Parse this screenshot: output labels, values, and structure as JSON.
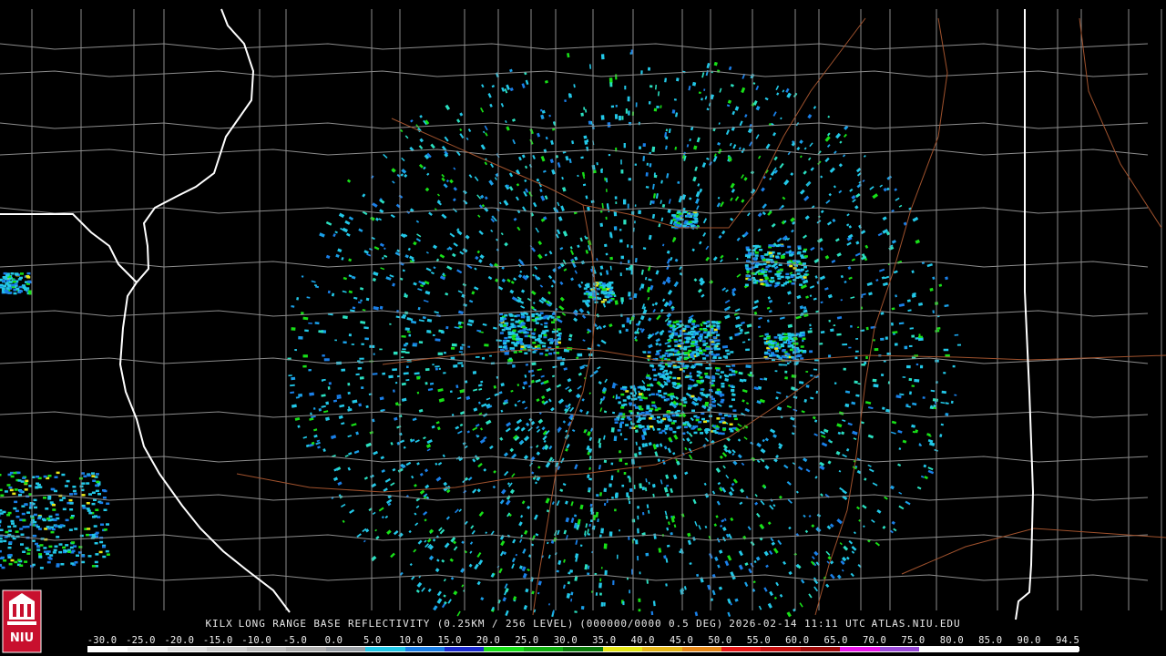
{
  "product": {
    "station": "KILX",
    "product_name": "LONG RANGE BASE REFLECTIVITY (0.25KM / 256 LEVEL)",
    "volume": "(000000/0000 0.5 DEG)",
    "datetime": "2026-02-14 11:11 UTC",
    "source": "ATLAS.NIU.EDU"
  },
  "logo": {
    "text": "NIU",
    "color": "#c8102e"
  },
  "scale": {
    "labels": [
      "-30.0",
      "-25.0",
      "-20.0",
      "-15.0",
      "-10.0",
      "-5.0",
      "0.0",
      "5.0",
      "10.0",
      "15.0",
      "20.0",
      "25.0",
      "30.0",
      "35.0",
      "40.0",
      "45.0",
      "50.0",
      "55.0",
      "60.0",
      "65.0",
      "70.0",
      "75.0",
      "80.0",
      "85.0",
      "90.0",
      "94.5"
    ],
    "colors": [
      "#ffffff",
      "#f0f0f0",
      "#e0e0e0",
      "#d0d0d0",
      "#c0c0c0",
      "#b0b0b0",
      "#9aa0a6",
      "#22c8e8",
      "#1a7fe8",
      "#1a2ad0",
      "#18e018",
      "#10b010",
      "#0a7a0a",
      "#e8e818",
      "#e8b818",
      "#e88818",
      "#e81818",
      "#c81010",
      "#a00a0a",
      "#e818e8",
      "#9a4ad8",
      "#ffffff",
      "#ffffff",
      "#ffffff",
      "#ffffff"
    ]
  },
  "map_colors": {
    "state_border": "#ffffff",
    "county_border": "#8c8c8c",
    "highway": "#a0522d"
  }
}
